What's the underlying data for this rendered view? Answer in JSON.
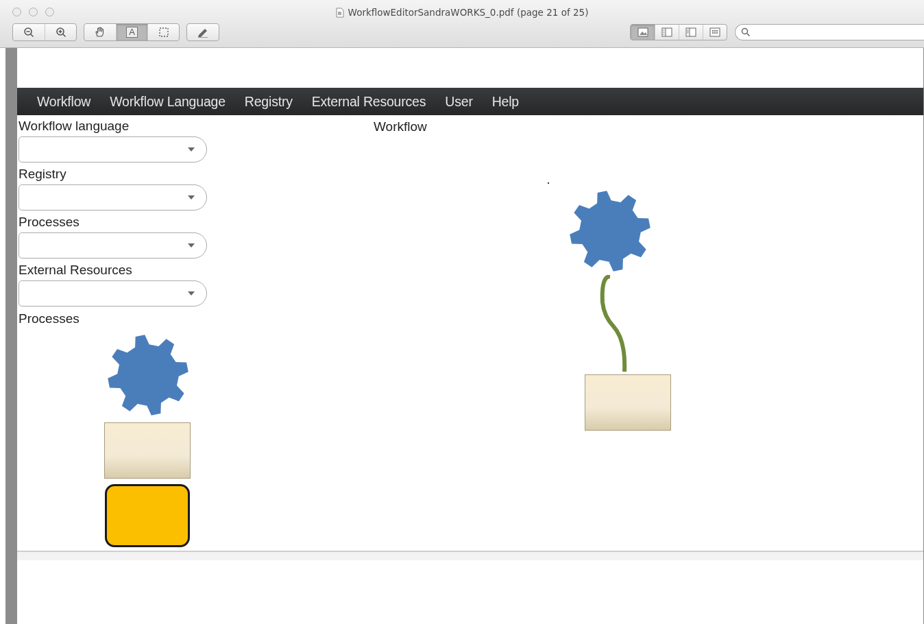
{
  "window": {
    "title": "WorkflowEditorSandraWORKS_0.pdf (page 21 of 25)"
  },
  "toolbar": {
    "zoom_tools": [
      {
        "kind": "zoom-out"
      },
      {
        "kind": "zoom-in"
      }
    ],
    "tools": [
      {
        "kind": "hand",
        "selected": false
      },
      {
        "kind": "text",
        "label": "A",
        "selected": true
      },
      {
        "kind": "select",
        "selected": false
      }
    ],
    "annotate": [
      {
        "kind": "pencil"
      }
    ],
    "view_modes": [
      {
        "kind": "content",
        "selected": true
      },
      {
        "kind": "thumbnails",
        "selected": false
      },
      {
        "kind": "toc",
        "selected": false
      },
      {
        "kind": "contact-sheet",
        "selected": false
      }
    ]
  },
  "menu": [
    "Workflow",
    "Workflow Language",
    "Registry",
    "External Resources",
    "User",
    "Help"
  ],
  "sidebar": {
    "dropdowns": [
      {
        "label": "Workflow language"
      },
      {
        "label": "Registry"
      },
      {
        "label": "Processes"
      },
      {
        "label": "External Resources"
      }
    ],
    "palette": {
      "title": "Processes",
      "items": [
        {
          "kind": "gear"
        },
        {
          "kind": "process-box"
        },
        {
          "kind": "rounded-box"
        }
      ]
    }
  },
  "canvas": {
    "title": "Workflow",
    "nodes": [
      {
        "kind": "dot"
      },
      {
        "kind": "gear"
      },
      {
        "kind": "connector"
      },
      {
        "kind": "process-box"
      }
    ]
  }
}
